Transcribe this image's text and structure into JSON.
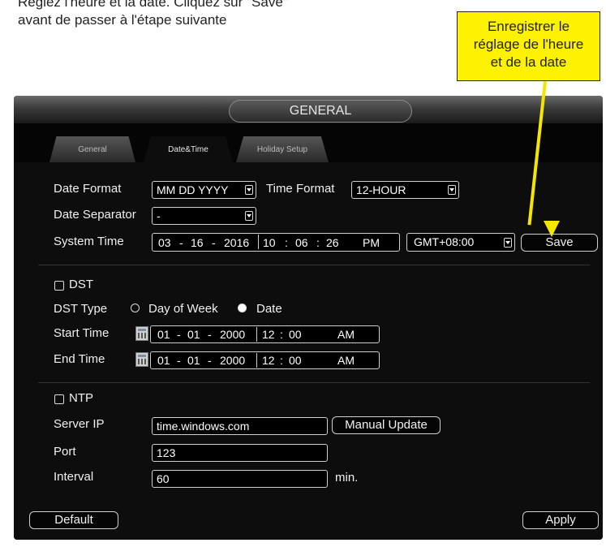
{
  "instructions": {
    "line1": "Réglez l'heure et la date. Cliquez sur \"Save\"",
    "line2": "avant de passer à l'étape suivante"
  },
  "callout": {
    "line1": "Enregistrer le",
    "line2": "réglage de l'heure",
    "line3": "et de la date",
    "color": "#fff200"
  },
  "window": {
    "title": "GENERAL"
  },
  "tabs": [
    "General",
    "Date&Time",
    "Holiday Setup"
  ],
  "datetime": {
    "date_format_label": "Date Format",
    "date_format_value": "MM DD YYYY",
    "time_format_label": "Time Format",
    "time_format_value": "12-HOUR",
    "date_separator_label": "Date Separator",
    "date_separator_value": "-",
    "system_time_label": "System Time",
    "system_time": {
      "month": "03",
      "day": "16",
      "year": "2016",
      "hour": "10",
      "minute": "06",
      "second": "26",
      "ampm": "PM"
    },
    "timezone": "GMT+08:00",
    "save_label": "Save"
  },
  "dst": {
    "label": "DST",
    "type_label": "DST Type",
    "option_week": "Day of Week",
    "option_date": "Date",
    "start_label": "Start Time",
    "start": {
      "month": "01",
      "day": "01",
      "year": "2000",
      "hour": "12",
      "minute": "00",
      "ampm": "AM"
    },
    "end_label": "End Time",
    "end": {
      "month": "01",
      "day": "01",
      "year": "2000",
      "hour": "12",
      "minute": "00",
      "ampm": "AM"
    }
  },
  "ntp": {
    "label": "NTP",
    "server_label": "Server IP",
    "server_value": "time.windows.com",
    "manual_update_label": "Manual Update",
    "port_label": "Port",
    "port_value": "123",
    "interval_label": "Interval",
    "interval_value": "60",
    "interval_unit": "min."
  },
  "footer": {
    "default_label": "Default",
    "apply_label": "Apply"
  },
  "separators": {
    "dash": "-",
    "colon": ":"
  }
}
